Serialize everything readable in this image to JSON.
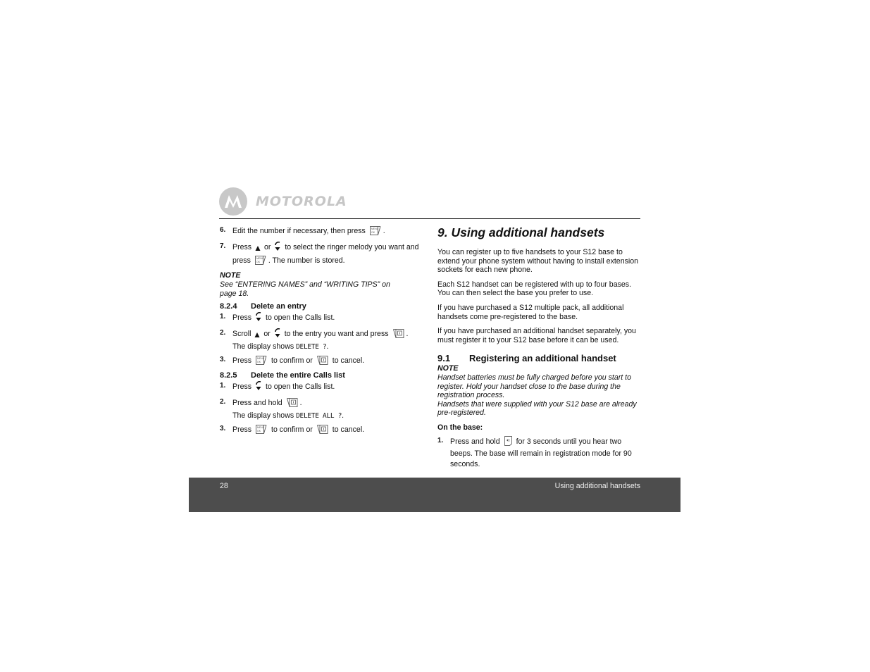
{
  "brand": {
    "name": "MOTOROLA",
    "logo_icon": "motorola-batwing-logo"
  },
  "icons": {
    "menu_ok": "menu-ok-key-icon",
    "up": "up-arrow-icon",
    "calls_down": "calls-down-key-icon",
    "delete": "delete-key-icon",
    "page": "page-find-button-icon"
  },
  "left": {
    "steps_top": [
      {
        "num": "6.",
        "parts": [
          "Edit the number if necessary, then press",
          "."
        ]
      },
      {
        "num": "7.",
        "parts": [
          "Press",
          "or",
          "to select the ringer melody you want and press",
          ". The number is stored."
        ]
      }
    ],
    "note": {
      "label": "NOTE",
      "text": "See “ENTERING NAMES” and “WRITING TIPS” on page 18."
    },
    "section_824": {
      "number": "8.2.4",
      "title": "Delete an entry",
      "steps": [
        {
          "num": "1.",
          "parts": [
            "Press",
            "to open the Calls list."
          ]
        },
        {
          "num": "2.",
          "parts": [
            "Scroll",
            "or",
            "to the entry you want and press",
            "."
          ],
          "sub_prefix": "The display shows",
          "display": "DELETE ?",
          "sub_suffix": "."
        },
        {
          "num": "3.",
          "parts": [
            "Press",
            "to confirm or",
            "to cancel."
          ]
        }
      ]
    },
    "section_825": {
      "number": "8.2.5",
      "title": "Delete the entire Calls list",
      "steps": [
        {
          "num": "1.",
          "parts": [
            "Press",
            "to open the Calls list."
          ]
        },
        {
          "num": "2.",
          "parts": [
            "Press and hold",
            "."
          ],
          "sub_prefix": "The display shows",
          "display": "DELETE ALL ?",
          "sub_suffix": "."
        },
        {
          "num": "3.",
          "parts": [
            "Press",
            "to confirm or",
            "to cancel."
          ]
        }
      ]
    }
  },
  "right": {
    "title": "9. Using additional handsets",
    "paragraphs": [
      "You can register up to five handsets to your S12 base to extend your phone system without having to install extension sockets for each new phone.",
      "Each S12 handset can be registered with up to four bases. You can then select the base you prefer to use.",
      "If you have purchased a S12 multiple pack, all additional handsets come pre-registered to the base.",
      "If you have purchased an additional handset separately, you must register it to your S12 base before it can be used."
    ],
    "section_91": {
      "number": "9.1",
      "title": "Registering an additional handset",
      "note_label": "NOTE",
      "note_lines": [
        "Handset batteries must be fully charged before you start to register. Hold your handset close to the base during the registration process.",
        "Handsets that were supplied with your S12 base are already pre-registered."
      ],
      "sublabel": "On the base:",
      "steps": [
        {
          "num": "1.",
          "parts": [
            "Press and hold",
            "for 3 seconds until you hear two beeps. The base will remain in registration mode for 90 seconds."
          ]
        }
      ]
    }
  },
  "footer": {
    "page_number": "28",
    "chapter": "Using additional handsets"
  }
}
